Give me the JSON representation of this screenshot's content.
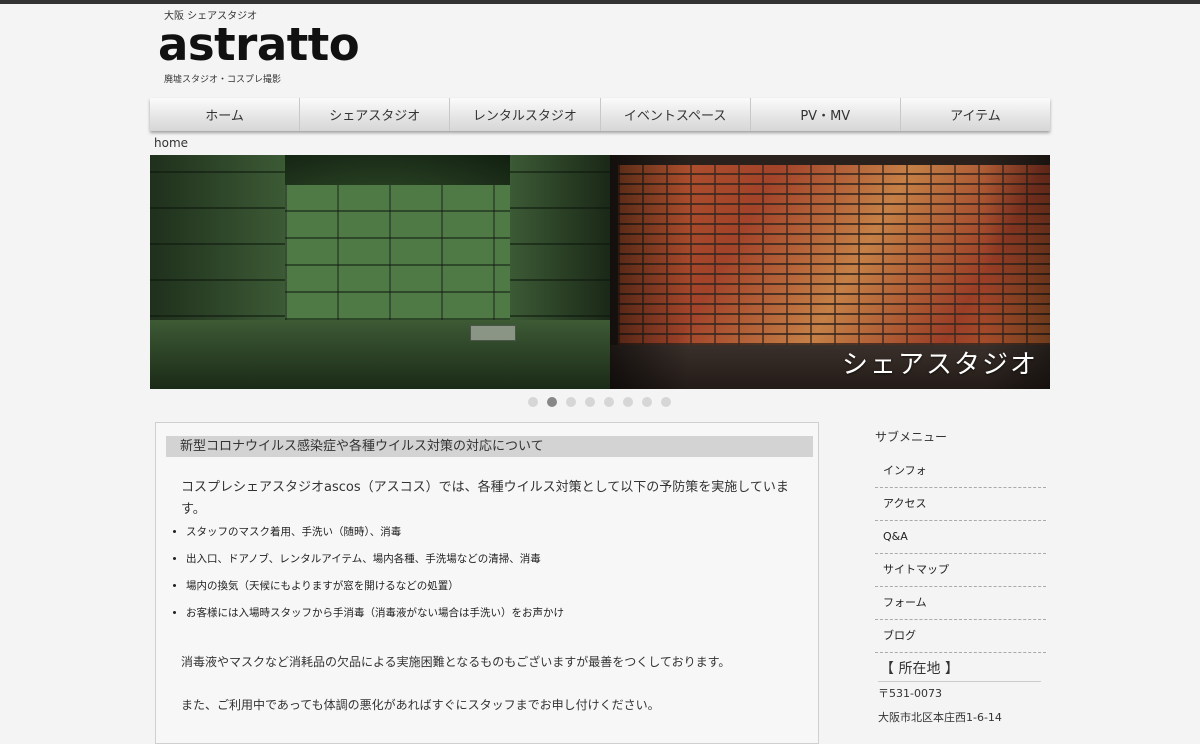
{
  "header": {
    "tagline": "大阪 シェアスタジオ",
    "logo": "astratto",
    "subtag": "廃墟スタジオ・コスプレ撮影"
  },
  "nav": {
    "items": [
      "ホーム",
      "シェアスタジオ",
      "レンタルスタジオ",
      "イベントスペース",
      "PV・MV",
      "アイテム"
    ]
  },
  "breadcrumb": "home",
  "slider": {
    "caption": "シェアスタジオ",
    "dot_count": 8,
    "active_dot": 1
  },
  "notice": {
    "heading": "新型コロナウイルス感染症や各種ウイルス対策の対応について",
    "intro": "コスプレシェアスタジオascos（アスコス）では、各種ウイルス対策として以下の予防策を実施しています。",
    "measures": [
      "スタッフのマスク着用、手洗い（随時）、消毒",
      "出入口、ドアノブ、レンタルアイテム、場内各種、手洗場などの清掃、消毒",
      "場内の換気（天候にもよりますが窓を開けるなどの処置）",
      "お客様には入場時スタッフから手消毒（消毒液がない場合は手洗い）をお声かけ"
    ],
    "para2": "消毒液やマスクなど消耗品の欠品による実施困難となるものもございますが最善をつくしております。",
    "para3": "また、ご利用中であっても体調の悪化があればすぐにスタッフまでお申し付けください。"
  },
  "sidebar": {
    "title": "サブメニュー",
    "items": [
      "インフォ",
      "アクセス",
      "Q&A",
      "サイトマップ",
      "フォーム",
      "ブログ"
    ],
    "location_title": "【 所在地 】",
    "postal": "〒531-0073",
    "address": "大阪市北区本庄西1-6-14"
  }
}
